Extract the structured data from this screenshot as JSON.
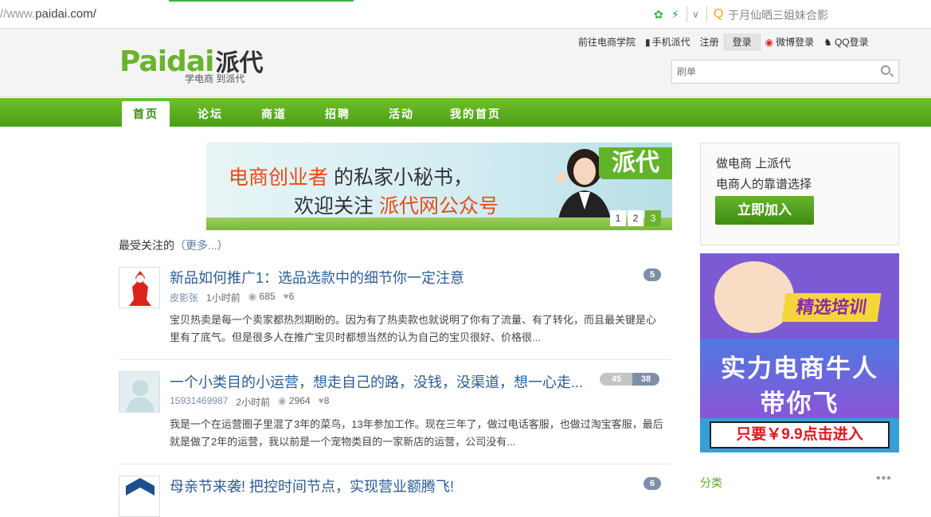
{
  "browser": {
    "url_prefix": "//www.",
    "url_domain": "paidai.com/",
    "search_text": "于月仙晒三姐妹合影"
  },
  "header": {
    "logo_word": "Paidai",
    "logo_cn": "派代",
    "tagline": "学电商 到派代",
    "links": [
      "前往电商学院",
      "手机派代",
      "注册",
      "登录",
      "微博登录",
      "QQ登录"
    ],
    "search_placeholder": "刷单"
  },
  "nav": {
    "items": [
      "首页",
      "论坛",
      "商道",
      "招聘",
      "活动",
      "我的首页"
    ],
    "active": "首页"
  },
  "banner": {
    "line1_red": "电商创业者",
    "line1_rest": " 的私家小秘书，",
    "line2_rest": "欢迎关注 ",
    "line2_red": "派代网公众号",
    "brand": "派代",
    "pages": [
      "1",
      "2",
      "3"
    ],
    "active_page": "3"
  },
  "section": {
    "title": "最受关注的",
    "more": "（更多...）"
  },
  "posts": [
    {
      "title": "新品如何推广1：选品选款中的细节你一定注意",
      "user": "皮影张",
      "time": "1小时前",
      "views": "685",
      "likes": "6",
      "desc": "宝贝热卖是每一个卖家都热烈期盼的。因为有了热卖款也就说明了你有了流量、有了转化，而且最关键是心里有了底气。但是很多人在推广宝贝时都想当然的认为自己的宝贝很好、价格很...",
      "badge": "5"
    },
    {
      "title": "一个小类目的小运营，想走自己的路，没钱，没渠道，想一心走...",
      "user": "15931469987",
      "time": "2小时前",
      "views": "2964",
      "likes": "8",
      "desc": "我是一个在运营圈子里混了3年的菜鸟，13年参加工作。现在三年了，做过电话客服，也做过淘宝客服，最后就是做了2年的运营，我以前是一个宠物类目的一家新店的运营，公司没有...",
      "badge_grey": "45",
      "badge": "38"
    },
    {
      "title": "母亲节来袭! 把控时间节点，实现营业额腾飞!",
      "badge": "6"
    }
  ],
  "sidebar": {
    "join_line1": "做电商 上派代",
    "join_line2": "电商人的靠谱选择",
    "join_button": "立即加入",
    "ad_tag": "精选培训",
    "ad_line1": "实力电商牛人",
    "ad_line2": "带你飞",
    "ad_cta": "只要￥9.9点击进入",
    "category_title": "分类",
    "category_more": "•••"
  },
  "colors": {
    "brand_green": "#6ab42c",
    "link_blue": "#2c5d95",
    "accent_red": "#e64a19"
  }
}
